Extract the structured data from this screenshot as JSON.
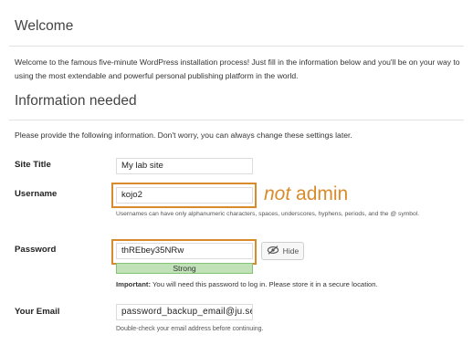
{
  "welcome": {
    "title": "Welcome",
    "intro": "Welcome to the famous five-minute WordPress installation process! Just fill in the information below and you'll be on your way to using the most extendable and powerful personal publishing platform in the world."
  },
  "info": {
    "title": "Information needed",
    "instructions": "Please provide the following information. Don't worry, you can always change these settings later."
  },
  "form": {
    "site_title": {
      "label": "Site Title",
      "value": "My lab site"
    },
    "username": {
      "label": "Username",
      "value": "kojo2",
      "help": "Usernames can have only alphanumeric characters, spaces, underscores, hyphens, periods, and the @ symbol."
    },
    "password": {
      "label": "Password",
      "value": "thREbey35NRw",
      "hide_label": "Hide",
      "strength": "Strong",
      "important_prefix": "Important:",
      "important_text": " You will need this password to log in. Please store it in a secure location."
    },
    "email": {
      "label": "Your Email",
      "value": "password_backup_email@ju.se",
      "help": "Double-check your email address before continuing."
    }
  },
  "annotation": {
    "emphasis": "not",
    "text": " admin"
  },
  "colors": {
    "annotation": "#d98b2b",
    "strength_bg": "#c1e1b9",
    "strength_border": "#83c373"
  },
  "icons": {
    "hide": "eye-slash-icon"
  }
}
